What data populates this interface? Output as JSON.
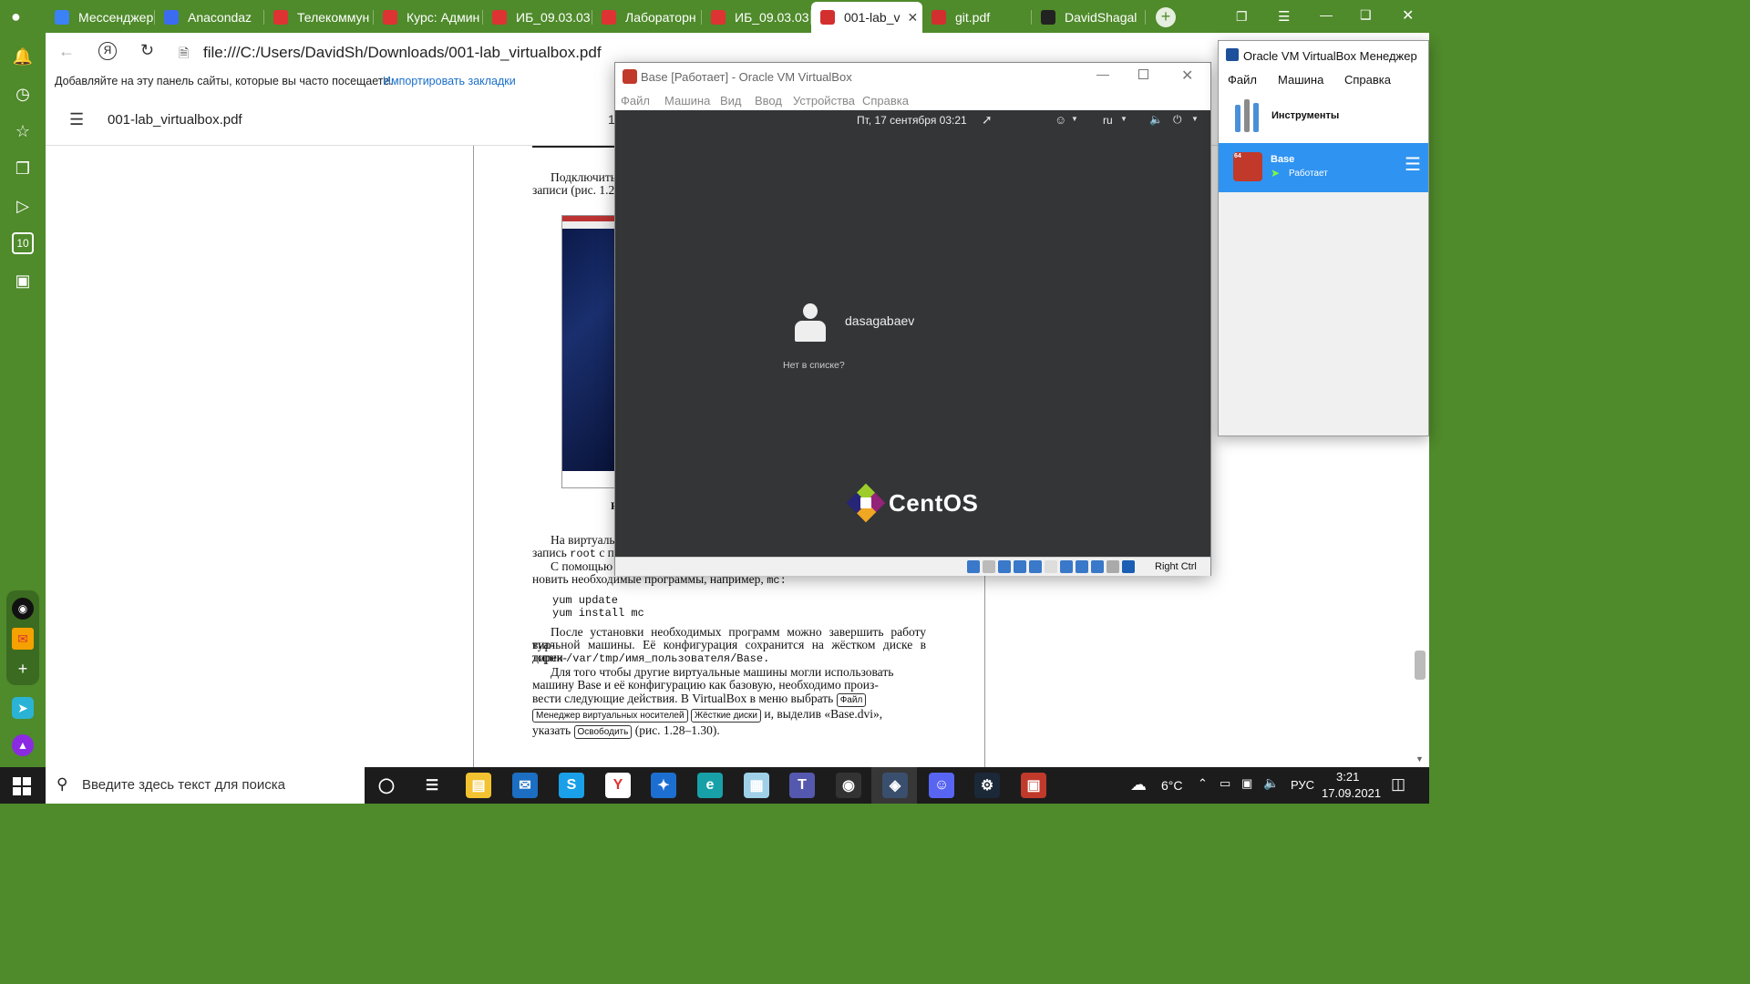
{
  "browser": {
    "tabs": [
      {
        "label": "Мессенджер",
        "icon": "messenger-icon",
        "color": "#3b82f6"
      },
      {
        "label": "Anacondaz",
        "icon": "music-icon",
        "color": "#3b6cf0"
      },
      {
        "label": "Телекоммун",
        "icon": "moodle-icon",
        "color": "#d33"
      },
      {
        "label": "Курс: Админ",
        "icon": "moodle-icon",
        "color": "#d33"
      },
      {
        "label": "ИБ_09.03.03",
        "icon": "moodle-icon",
        "color": "#d33"
      },
      {
        "label": "Лабораторн",
        "icon": "moodle-icon",
        "color": "#d33"
      },
      {
        "label": "ИБ_09.03.03",
        "icon": "moodle-icon",
        "color": "#d33"
      },
      {
        "label": "001-lab_v",
        "icon": "pdf-icon",
        "color": "#d32f2f",
        "active": true
      },
      {
        "label": "git.pdf",
        "icon": "pdf-icon",
        "color": "#d32f2f"
      },
      {
        "label": "DavidShagal",
        "icon": "github-icon",
        "color": "#222"
      }
    ],
    "address": "file:///C:/Users/DavidSh/Downloads/001-lab_virtualbox.pdf",
    "bookmarks_hint": "Добавляйте на эту панель сайты, которые вы часто посещаете.",
    "bookmarks_link": "Импортировать закладки",
    "pdf_title": "001-lab_virtualbox.pdf",
    "page_indicator": "1"
  },
  "pdf": {
    "para1": "Подключить",
    "para1b": "записи (рис. 1.2",
    "para2": "На виртуаль",
    "para2b": "запись",
    "para2b_code": "root",
    "para2b_tail": "с п",
    "para3": "С помощью",
    "para3b": "новить необходимые программы, например,",
    "para3b_code": "mc:",
    "code1": "yum update",
    "code2": "yum install mc",
    "para4": "После установки необходимых программ можно завершить работу вир-",
    "para4b": "туальной машины. Её конфигурация сохранится на жёстком диске в дирек-",
    "para4c": "тории",
    "para4c_code": "/var/tmp/имя_пользователя/Base.",
    "para5": "Для того чтобы другие виртуальные машины могли использовать",
    "para5b": "машину Base и её конфигурацию как базовую, необходимо произ-",
    "para5c": "вести следующие действия. В VirtualBox в меню выбрать",
    "kbd_file": "Файл",
    "kbd_media": "Менеджер виртуальных носителей",
    "kbd_disks": "Жёсткие диски",
    "para5d_tail": "и, выделив «Base.dvi»,",
    "para5e": "указать",
    "kbd_release": "Освободить",
    "para5e_tail": "(рис. 1.28–1.30).",
    "caption_fragment": "Р"
  },
  "vm": {
    "title": "Base [Работает] - Oracle VM VirtualBox",
    "menu": [
      "Файл",
      "Машина",
      "Вид",
      "Ввод",
      "Устройства",
      "Справка"
    ],
    "clock": "Пт, 17 сентября  03:21",
    "lang": "ru",
    "username": "dasagabaev",
    "not_listed": "Нет в списке?",
    "os_logo": "CentOS",
    "host_key": "Right Ctrl"
  },
  "manager": {
    "title": "Oracle VM VirtualBox Менеджер",
    "menu": [
      "Файл",
      "Машина",
      "Справка"
    ],
    "tools_label": "Инструменты",
    "vm_name": "Base",
    "vm_state": "Работает",
    "vm_badge": "64"
  },
  "taskbar": {
    "search_placeholder": "Введите здесь текст для поиска",
    "weather": "6°C",
    "lang": "РУС",
    "time": "3:21",
    "date": "17.09.2021"
  }
}
